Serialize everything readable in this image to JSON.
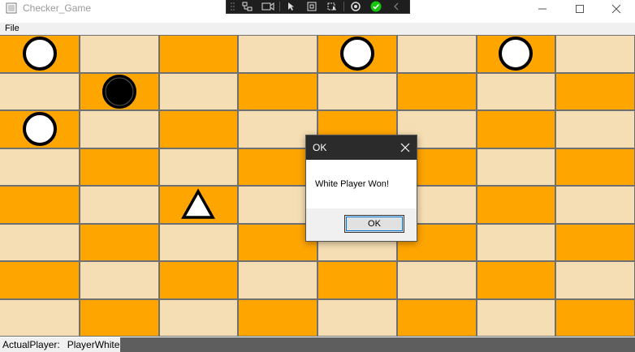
{
  "window": {
    "title": "Checker_Game"
  },
  "menu": {
    "file_label": "File"
  },
  "board": {
    "rows": 8,
    "cols": 8,
    "pieces": [
      {
        "row": 0,
        "col": 0,
        "type": "white-piece"
      },
      {
        "row": 0,
        "col": 4,
        "type": "white-piece"
      },
      {
        "row": 0,
        "col": 6,
        "type": "white-piece"
      },
      {
        "row": 1,
        "col": 1,
        "type": "black-piece"
      },
      {
        "row": 2,
        "col": 0,
        "type": "white-piece"
      },
      {
        "row": 4,
        "col": 2,
        "type": "move-marker"
      }
    ]
  },
  "status": {
    "label": "ActualPlayer:",
    "value": "PlayerWhite"
  },
  "dialog": {
    "title": "OK",
    "message": "White Player Won!",
    "ok_label": "OK"
  },
  "colors": {
    "light_square": "#f5deb3",
    "dark_square": "#ffa500",
    "grid_line": "#707070"
  }
}
